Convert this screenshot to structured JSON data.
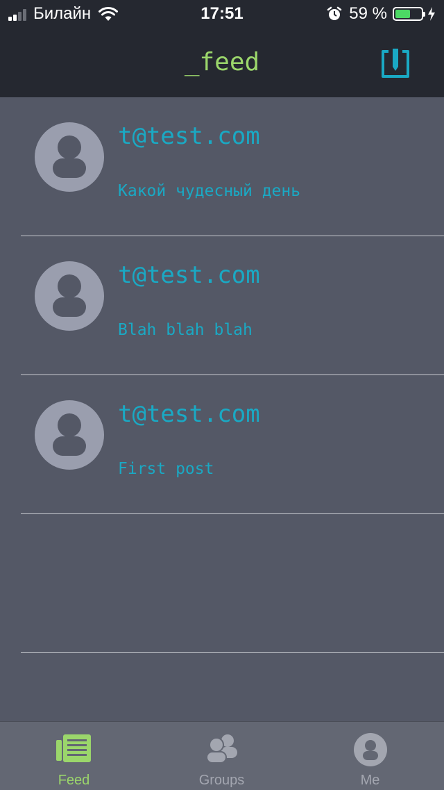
{
  "status_bar": {
    "carrier": "Билайн",
    "time": "17:51",
    "battery_percent": "59 %",
    "battery_level": 0.59,
    "signal_bars": 2,
    "icons": [
      "signal-icon",
      "wifi-icon",
      "alarm-icon",
      "battery-icon",
      "charging-icon"
    ]
  },
  "nav": {
    "title": "_feed",
    "compose_icon": "compose-icon"
  },
  "posts": [
    {
      "author": "t@test.com",
      "text": "Какой чудесный день"
    },
    {
      "author": "t@test.com",
      "text": "Blah blah blah"
    },
    {
      "author": "t@test.com",
      "text": "First post"
    }
  ],
  "tabs": [
    {
      "label": "Feed",
      "icon": "newspaper-icon",
      "active": true
    },
    {
      "label": "Groups",
      "icon": "group-icon",
      "active": false
    },
    {
      "label": "Me",
      "icon": "user-icon",
      "active": false
    }
  ],
  "colors": {
    "accent_green": "#9bd66b",
    "accent_cyan": "#1aa9c4",
    "nav_background": "#252830",
    "content_background": "#545866",
    "tab_inactive": "#a3a6b0",
    "avatar": "#9a9eae"
  }
}
